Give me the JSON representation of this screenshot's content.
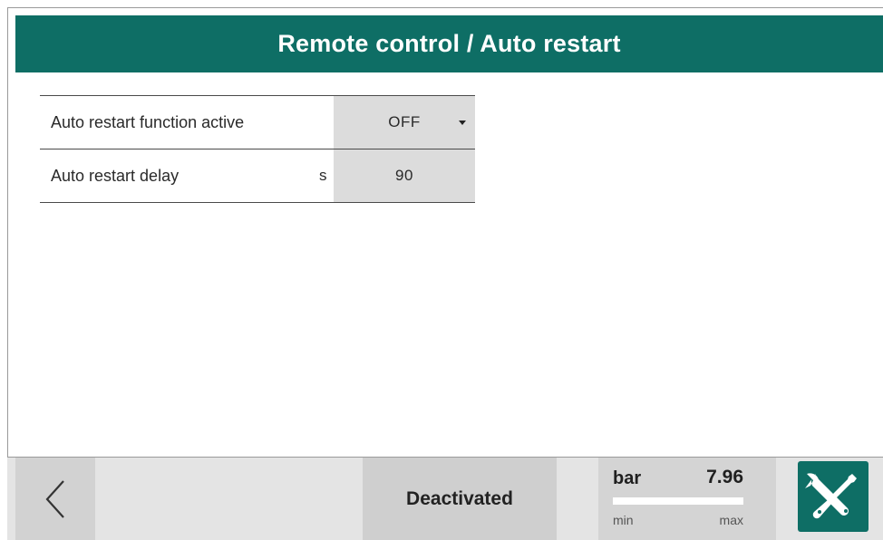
{
  "header": {
    "title": "Remote control / Auto restart"
  },
  "settings": {
    "rows": [
      {
        "label": "Auto restart function active",
        "unit": "",
        "value": "OFF",
        "type": "dropdown"
      },
      {
        "label": "Auto restart delay",
        "unit": "s",
        "value": "90",
        "type": "numeric"
      }
    ]
  },
  "footer": {
    "back_icon": "chevron-left-icon",
    "status": "Deactivated",
    "gauge": {
      "unit": "bar",
      "value": "7.96",
      "min_label": "min",
      "max_label": "max",
      "fill_fraction": 1.0
    },
    "tools_icon": "wrench-screwdriver-icon"
  },
  "colors": {
    "accent": "#0e6e65",
    "value_cell": "#dcdcdc",
    "footer_bg": "#e4e4e4"
  }
}
